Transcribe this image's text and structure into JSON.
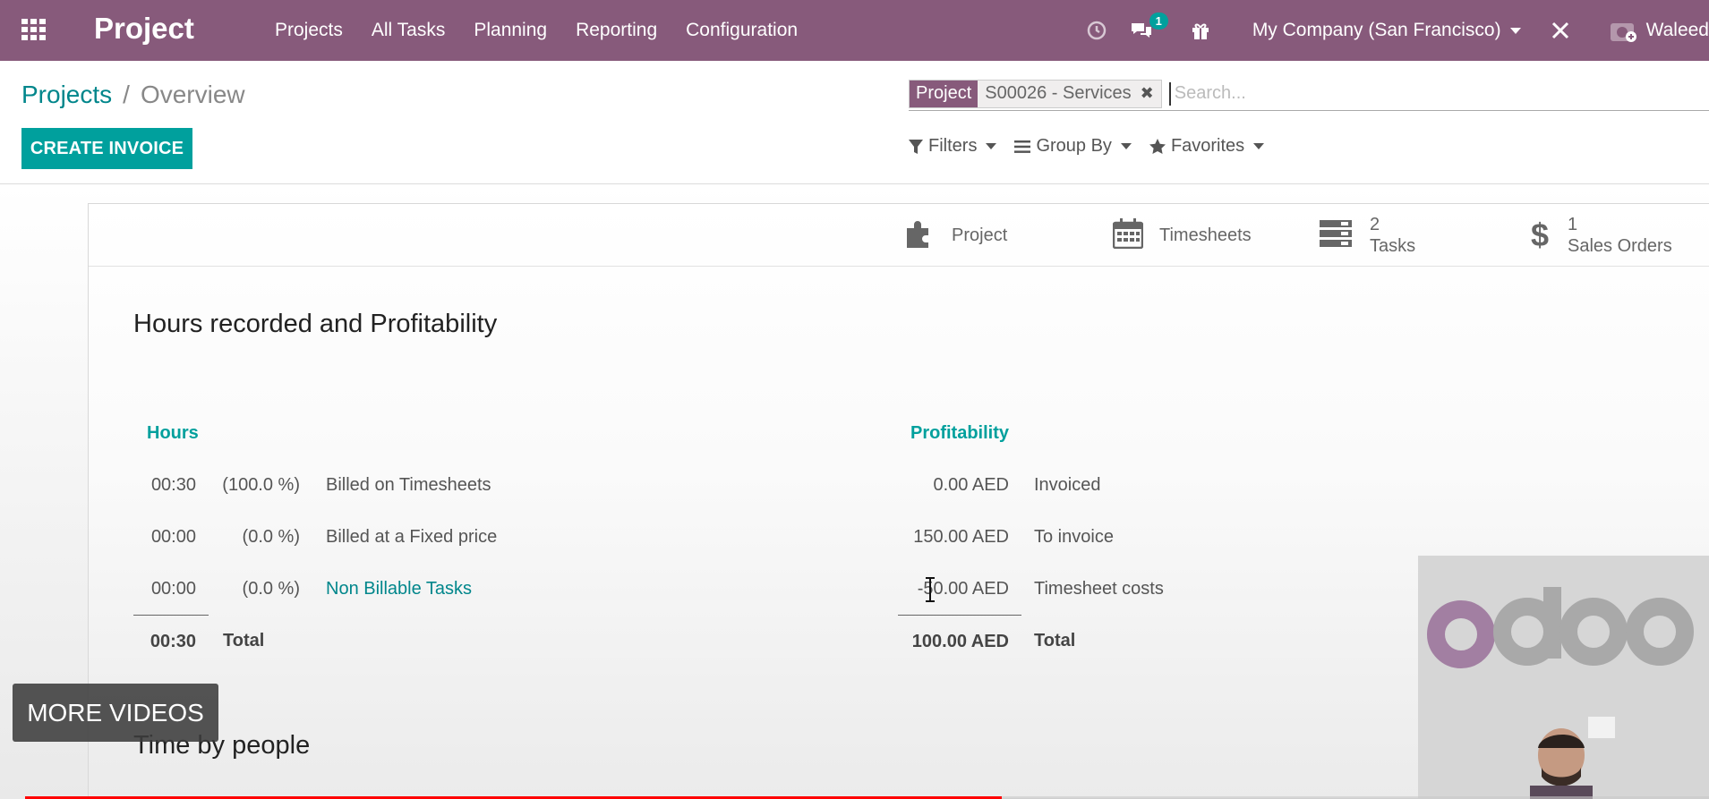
{
  "navbar": {
    "app_title": "Project",
    "menu": [
      "Projects",
      "All Tasks",
      "Planning",
      "Reporting",
      "Configuration"
    ],
    "message_badge": "1",
    "company": "My Company (San Francisco)",
    "user_name": "Waleed"
  },
  "breadcrumb": {
    "parent": "Projects",
    "separator": "/",
    "current": "Overview"
  },
  "toolbar": {
    "create_invoice": "CREATE INVOICE"
  },
  "search": {
    "facet_category": "Project",
    "facet_value": "S00026 - Services",
    "placeholder": "Search..."
  },
  "filters": {
    "filters": "Filters",
    "group_by": "Group By",
    "favorites": "Favorites"
  },
  "stat_buttons": {
    "project": "Project",
    "timesheets": "Timesheets",
    "tasks_count": "2",
    "tasks_label": "Tasks",
    "sales_count": "1",
    "sales_label": "Sales Orders"
  },
  "section1_title": "Hours recorded and Profitability",
  "hours": {
    "heading": "Hours",
    "rows": [
      {
        "time": "00:30",
        "pct": "(100.0 %)",
        "label": "Billed on Timesheets"
      },
      {
        "time": "00:00",
        "pct": "(0.0 %)",
        "label": "Billed at a Fixed price"
      },
      {
        "time": "00:00",
        "pct": "(0.0 %)",
        "label": "Non Billable Tasks"
      }
    ],
    "total_time": "00:30",
    "total_label": "Total"
  },
  "profitability": {
    "heading": "Profitability",
    "rows": [
      {
        "amount": "0.00 AED",
        "label": "Invoiced"
      },
      {
        "amount": "150.00 AED",
        "label": "To invoice"
      },
      {
        "amount": "-50.00 AED",
        "label": "Timesheet costs"
      }
    ],
    "total_amount": "100.00 AED",
    "total_label": "Total"
  },
  "section2_title": "Time by people",
  "overlay": {
    "more_videos": "MORE VIDEOS",
    "progress": 0.58
  },
  "colors": {
    "navbar": "#875a7b",
    "accent": "#00a09d",
    "link": "#00868b"
  }
}
